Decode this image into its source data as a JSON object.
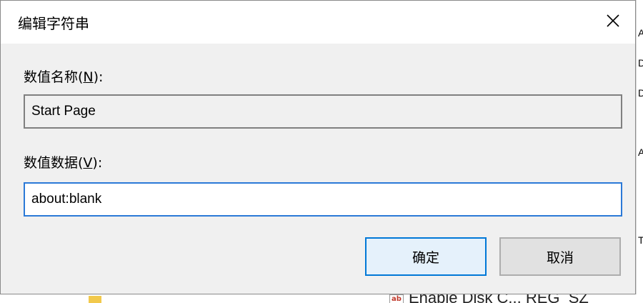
{
  "dialog": {
    "title": "编辑字符串",
    "close_glyph": "✕"
  },
  "value_name": {
    "label_prefix": "数值名称(",
    "label_accel": "N",
    "label_suffix": "):",
    "value": "Start Page"
  },
  "value_data": {
    "label_prefix": "数值数据(",
    "label_accel": "V",
    "label_suffix": "):",
    "value": "about:blank"
  },
  "buttons": {
    "ok_label": "确定",
    "cancel_label": "取消"
  },
  "background": {
    "right_fragments": [
      "A",
      "D",
      "D",
      "A",
      "T"
    ],
    "bottom_text": "Enable Disk C... REG_SZ",
    "reg_icon_text": "ab"
  },
  "colors": {
    "accent": "#0078d7",
    "focus_border": "#2b79d7",
    "dialog_bg": "#f0f0f0"
  }
}
